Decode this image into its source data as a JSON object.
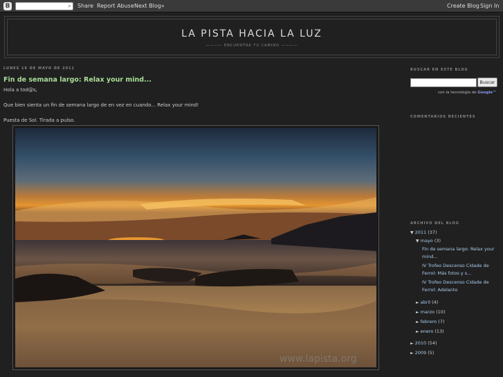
{
  "navbar": {
    "logo_letter": "B",
    "share": "Share",
    "report_abuse": "Report Abuse",
    "next_blog": "Next Blog»",
    "create_blog": "Create Blog",
    "sign_in": "Sign In"
  },
  "header": {
    "title": "LA PISTA HACIA LA LUZ",
    "description": "———— ENCUENTRA TU CAMINO ————"
  },
  "post": {
    "date": "LUNES 16 DE MAYO DE 2011",
    "title": "Fin de semana largo: Relax your mind...",
    "greeting": "Hola a tod@s,",
    "line1": "Que bien sienta un fin de semana largo de en vez en cuando... Relax your mind!",
    "line2": "Puesta de Sol. Tirada a pulso.",
    "watermark": "www.lapista.org"
  },
  "sidebar": {
    "search_title": "BUSCAR EN ESTE BLOG",
    "search_button": "Buscar",
    "powered_by": "con la tecnología de",
    "google": "Google™",
    "recent_comments_title": "COMENTARIOS RECIENTES",
    "archive_title": "ARCHIVO DEL BLOG",
    "archive": {
      "y2011": {
        "label": "2011",
        "count": "(37)"
      },
      "mayo": {
        "label": "mayo",
        "count": "(3)"
      },
      "posts": [
        {
          "line1": "Fin de semana largo: Relax your",
          "line2": "mind..."
        },
        {
          "line1": "IV Trofeo Descenso Cidade de",
          "line2": "Ferrol: Más fotos y s..."
        },
        {
          "line1": "IV Trofeo Descenso Cidade de",
          "line2": "Ferrol: Adelanto"
        }
      ],
      "months": [
        {
          "label": "abril",
          "count": "(4)"
        },
        {
          "label": "marzo",
          "count": "(10)"
        },
        {
          "label": "febrero",
          "count": "(7)"
        },
        {
          "label": "enero",
          "count": "(13)"
        }
      ],
      "y2010": {
        "label": "2010",
        "count": "(54)"
      },
      "y2009": {
        "label": "2009",
        "count": "(5)"
      }
    }
  }
}
